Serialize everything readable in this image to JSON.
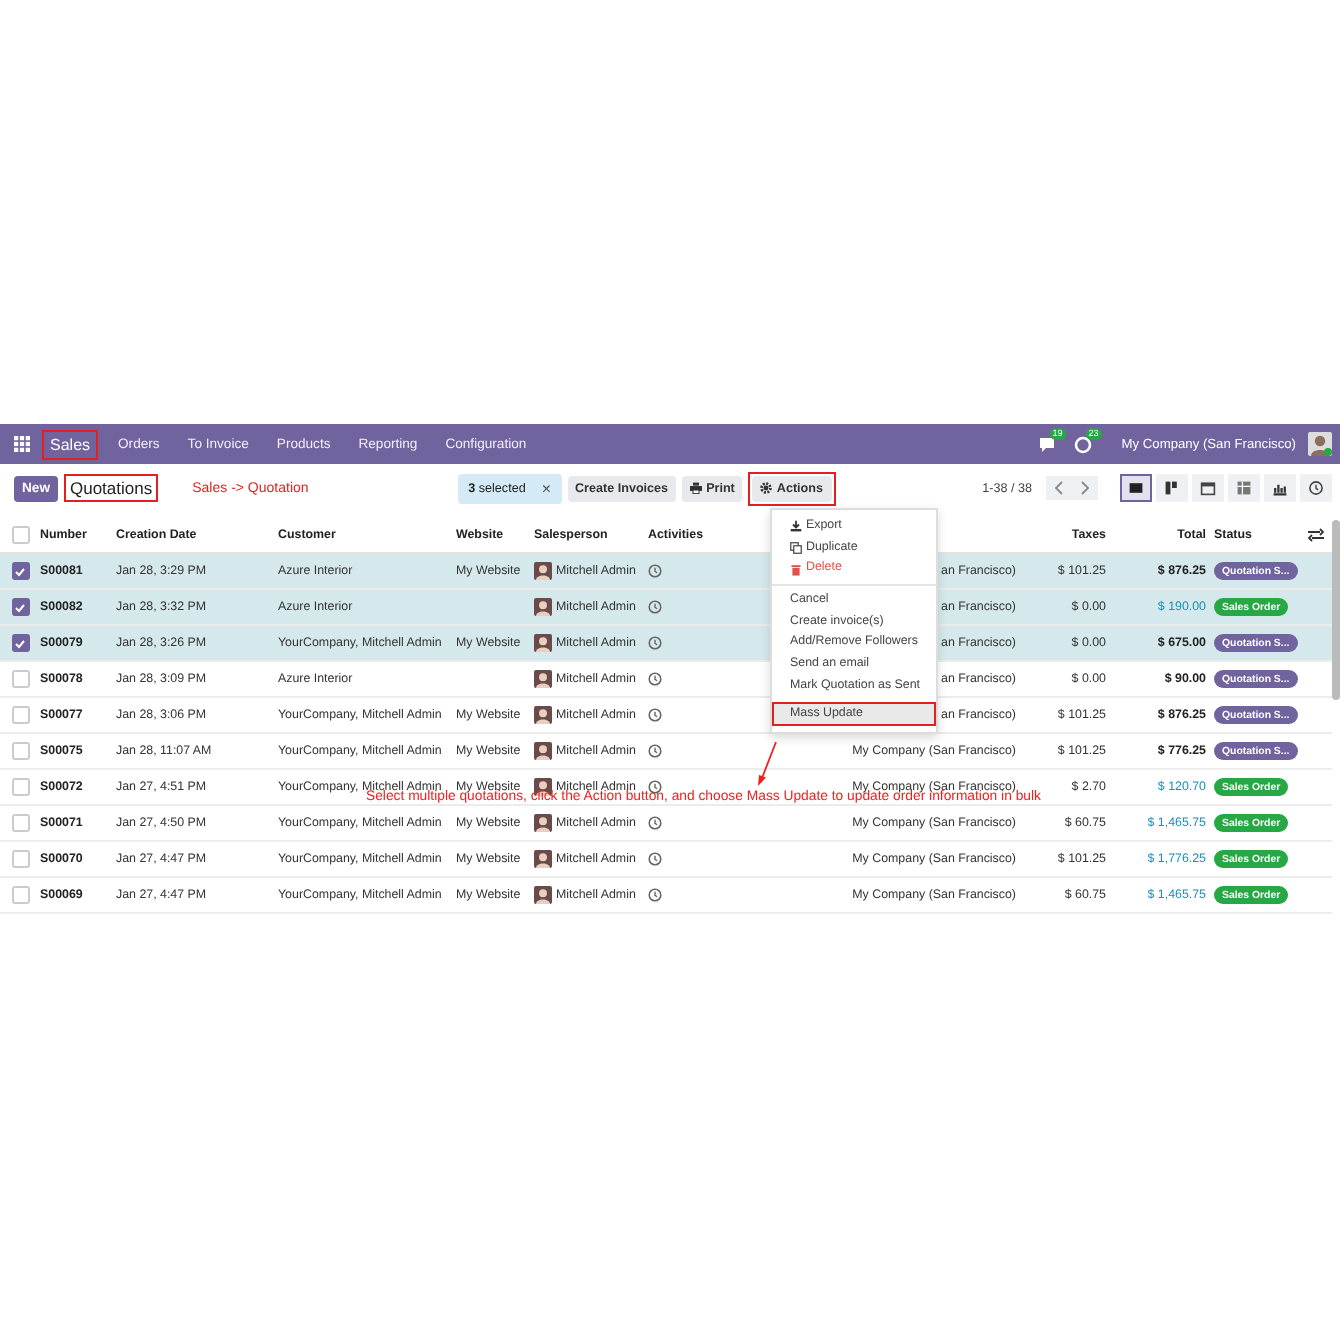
{
  "navbar": {
    "apps": [
      {
        "label": "Sales",
        "highlighted": true
      },
      {
        "label": "Orders",
        "highlighted": false
      },
      {
        "label": "To Invoice",
        "highlighted": false
      },
      {
        "label": "Products",
        "highlighted": false
      },
      {
        "label": "Reporting",
        "highlighted": false
      },
      {
        "label": "Configuration",
        "highlighted": false
      }
    ],
    "chat_badge": "19",
    "activity_badge": "23",
    "company": "My Company (San Francisco)"
  },
  "control_panel": {
    "new_button": "New",
    "breadcrumb": {
      "label": "Quotations",
      "highlighted": true
    },
    "note": "Sales -> Quotation",
    "selection": {
      "label": "**3** selected",
      "clear": "×"
    },
    "create_invoices": "Create Invoices",
    "print": "Print",
    "actions": {
      "label": "Actions",
      "highlighted": true
    },
    "pager": "1-38 / 38",
    "views": [
      {
        "kind": "list",
        "selected": true
      },
      {
        "kind": "kanban",
        "selected": false
      },
      {
        "kind": "calendar",
        "selected": false
      },
      {
        "kind": "pivot",
        "selected": false
      },
      {
        "kind": "graph",
        "selected": false
      },
      {
        "kind": "activity",
        "selected": false
      }
    ]
  },
  "table": {
    "select_all_checked": false,
    "columns": {
      "number": "Number",
      "date": "Creation Date",
      "customer": "Customer",
      "website": "Website",
      "salesperson": "Salesperson",
      "activities": "Activities",
      "taxes": "Taxes",
      "total": "Total",
      "status": "Status"
    },
    "rows": [
      {
        "selected": true,
        "number": "S00081",
        "date": "Jan 28, 3:29 PM",
        "customer": "Azure Interior",
        "website": "My Website",
        "salesperson": "Mitchell Admin",
        "company": "an Francisco)",
        "taxes": "$ 101.25",
        "total": "$ 876.25",
        "status": {
          "label": "Quotation S...",
          "kind": "quotation"
        }
      },
      {
        "selected": true,
        "number": "S00082",
        "date": "Jan 28, 3:32 PM",
        "customer": "Azure Interior",
        "salesperson": "Mitchell Admin",
        "company": "an Francisco)",
        "taxes": "$ 0.00",
        "total": "$ 190.00",
        "status": {
          "label": "Sales Order",
          "kind": "order"
        }
      },
      {
        "selected": true,
        "number": "S00079",
        "date": "Jan 28, 3:26 PM",
        "customer": "YourCompany, Mitchell Admin",
        "website": "My Website",
        "salesperson": "Mitchell Admin",
        "company": "an Francisco)",
        "taxes": "$ 0.00",
        "total": "$ 675.00",
        "status": {
          "label": "Quotation S...",
          "kind": "quotation"
        }
      },
      {
        "selected": false,
        "number": "S00078",
        "date": "Jan 28, 3:09 PM",
        "customer": "Azure Interior",
        "salesperson": "Mitchell Admin",
        "company": "an Francisco)",
        "taxes": "$ 0.00",
        "total": "$ 90.00",
        "status": {
          "label": "Quotation S...",
          "kind": "quotation"
        }
      },
      {
        "selected": false,
        "number": "S00077",
        "date": "Jan 28, 3:06 PM",
        "customer": "YourCompany, Mitchell Admin",
        "website": "My Website",
        "salesperson": "Mitchell Admin",
        "company": "an Francisco)",
        "taxes": "$ 101.25",
        "total": "$ 876.25",
        "status": {
          "label": "Quotation S...",
          "kind": "quotation"
        }
      },
      {
        "selected": false,
        "number": "S00075",
        "date": "Jan 28, 11:07 AM",
        "customer": "YourCompany, Mitchell Admin",
        "website": "My Website",
        "salesperson": "Mitchell Admin",
        "company": "My Company (San Francisco)",
        "taxes": "$ 101.25",
        "total": "$ 776.25",
        "status": {
          "label": "Quotation S...",
          "kind": "quotation"
        }
      },
      {
        "selected": false,
        "number": "S00072",
        "date": "Jan 27, 4:51 PM",
        "customer": "YourCompany, Mitchell Admin",
        "website": "My Website",
        "salesperson": "Mitchell Admin",
        "company": "My Company (San Francisco)",
        "taxes": "$ 2.70",
        "total": "$ 120.70",
        "status": {
          "label": "Sales Order",
          "kind": "order"
        }
      },
      {
        "selected": false,
        "number": "S00071",
        "date": "Jan 27, 4:50 PM",
        "customer": "YourCompany, Mitchell Admin",
        "website": "My Website",
        "salesperson": "Mitchell Admin",
        "company": "My Company (San Francisco)",
        "taxes": "$ 60.75",
        "total": "$ 1,465.75",
        "status": {
          "label": "Sales Order",
          "kind": "order"
        }
      },
      {
        "selected": false,
        "number": "S00070",
        "date": "Jan 27, 4:47 PM",
        "customer": "YourCompany, Mitchell Admin",
        "website": "My Website",
        "salesperson": "Mitchell Admin",
        "company": "My Company (San Francisco)",
        "taxes": "$ 101.25",
        "total": "$ 1,776.25",
        "status": {
          "label": "Sales Order",
          "kind": "order"
        }
      },
      {
        "selected": false,
        "number": "S00069",
        "date": "Jan 27, 4:47 PM",
        "customer": "YourCompany, Mitchell Admin",
        "website": "My Website",
        "salesperson": "Mitchell Admin",
        "company": "My Company (San Francisco)",
        "taxes": "$ 60.75",
        "total": "$ 1,465.75",
        "status": {
          "label": "Sales Order",
          "kind": "order"
        }
      }
    ]
  },
  "actions_menu": {
    "groups": [
      {
        "items": [
          {
            "label": "Export",
            "kind": "export",
            "highlighted": false
          },
          {
            "label": "Duplicate",
            "kind": "duplicate",
            "highlighted": false
          },
          {
            "label": "Delete",
            "kind": "delete",
            "highlighted": false
          }
        ]
      },
      {
        "items": [
          {
            "label": "Cancel",
            "kind": "plain",
            "highlighted": false
          },
          {
            "label": "Create invoice(s)",
            "kind": "plain",
            "highlighted": false
          },
          {
            "label": "Add/Remove Followers",
            "kind": "plain",
            "highlighted": false
          },
          {
            "label": "Send an email",
            "kind": "plain",
            "highlighted": false
          },
          {
            "label": "Mark Quotation as Sent",
            "kind": "plain",
            "highlighted": false
          },
          {
            "label": "Mass Update",
            "kind": "plain",
            "highlighted": true
          }
        ]
      }
    ]
  },
  "annotation": {
    "text": "Select multiple quotations, click the Action button, and choose Mass Update to update order information in bulk"
  }
}
